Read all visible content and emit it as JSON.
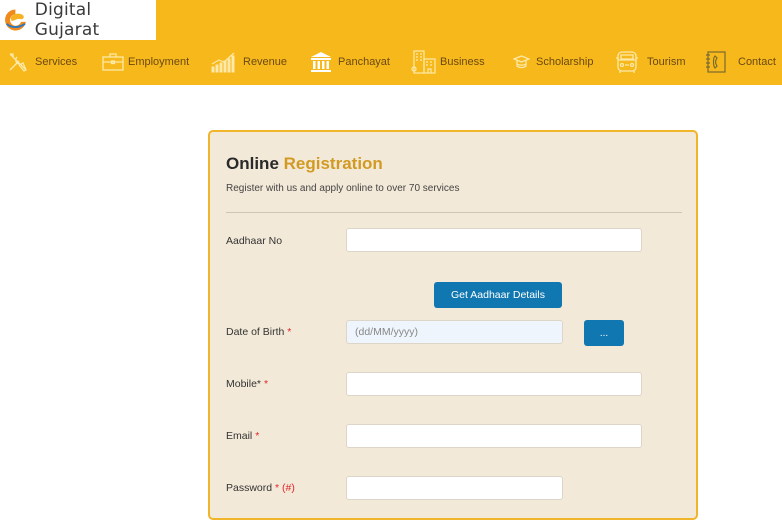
{
  "brand": {
    "name": "Digital Gujarat",
    "logo_icon": "digital-gujarat-logo-icon",
    "colors": {
      "header_bg": "#f7b81b",
      "accent_text": "#d29a22",
      "button": "#1177b0",
      "card_bg": "#f3e9d8",
      "card_border": "#f0b52b",
      "required": "#e3262b"
    }
  },
  "nav": {
    "items": [
      {
        "label": "Services",
        "icon": "tools-icon"
      },
      {
        "label": "Employment",
        "icon": "briefcase-icon"
      },
      {
        "label": "Revenue",
        "icon": "growth-chart-icon"
      },
      {
        "label": "Panchayat",
        "icon": "government-building-icon"
      },
      {
        "label": "Business",
        "icon": "office-buildings-icon"
      },
      {
        "label": "Scholarship",
        "icon": "graduation-cap-icon"
      },
      {
        "label": "Tourism",
        "icon": "bus-icon"
      },
      {
        "label": "Contact",
        "icon": "phone-book-icon"
      }
    ]
  },
  "form": {
    "title_part1": "Online",
    "title_part2": "Registration",
    "subtitle": "Register with us and apply online to over 70 services",
    "fields": {
      "aadhaar": {
        "label": "Aadhaar No",
        "value": "",
        "placeholder": ""
      },
      "dob": {
        "label": "Date of Birth",
        "required_mark": "*",
        "value": "",
        "placeholder": "(dd/MM/yyyy)"
      },
      "mobile": {
        "label": "Mobile*",
        "required_mark": "*",
        "value": "",
        "placeholder": ""
      },
      "email": {
        "label": "Email",
        "required_mark": "*",
        "value": "",
        "placeholder": ""
      },
      "password": {
        "label": "Password",
        "required_mark": "*",
        "note": "(#)",
        "value": "",
        "placeholder": ""
      }
    },
    "get_aadhaar_button": "Get Aadhaar Details",
    "date_picker_button": "..."
  }
}
